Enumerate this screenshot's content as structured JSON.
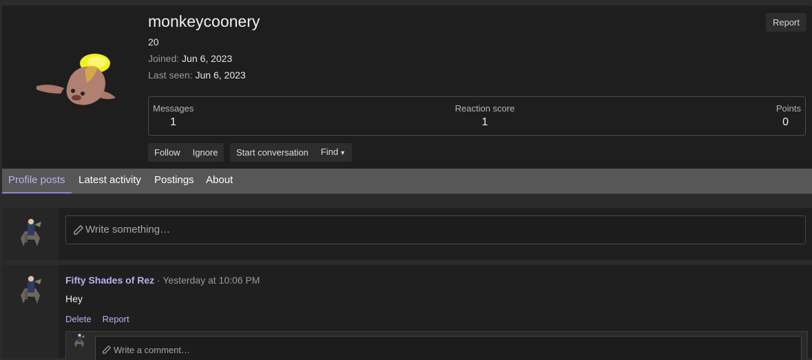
{
  "profile": {
    "username": "monkeycoonery",
    "age": "20",
    "joined_label": "Joined:",
    "joined_value": "Jun 6, 2023",
    "last_seen_label": "Last seen:",
    "last_seen_value": "Jun 6, 2023",
    "report_label": "Report",
    "avatar_icon": "pokemon-sprite-avatar-icon"
  },
  "stats": [
    {
      "label": "Messages",
      "value": "1"
    },
    {
      "label": "Reaction score",
      "value": "1"
    },
    {
      "label": "Points",
      "value": "0"
    }
  ],
  "actions": {
    "follow": "Follow",
    "ignore": "Ignore",
    "start_conversation": "Start conversation",
    "find": "Find"
  },
  "tabs": [
    {
      "label": "Profile posts",
      "active": true
    },
    {
      "label": "Latest activity",
      "active": false
    },
    {
      "label": "Postings",
      "active": false
    },
    {
      "label": "About",
      "active": false
    }
  ],
  "composer": {
    "placeholder": "Write something…"
  },
  "post": {
    "author": "Fifty Shades of Rez",
    "separator": "·",
    "time": "Yesterday at 10:06 PM",
    "body": "Hey",
    "delete_label": "Delete",
    "report_label": "Report",
    "comment_placeholder": "Write a comment…"
  },
  "colors": {
    "accent": "#b9b2f0",
    "panel": "#1e1e1e",
    "tabbar": "#575757"
  }
}
